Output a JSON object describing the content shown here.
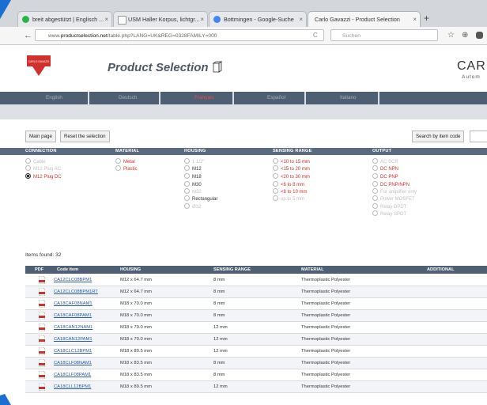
{
  "browser": {
    "tabs": [
      {
        "label": "breit abgestützt | Englisch ...",
        "icon": "green-circle-icon"
      },
      {
        "label": "USM Haller Korpus, lichtgr...",
        "icon": "page-icon"
      },
      {
        "label": "Bottmingen - Google-Suche",
        "icon": "google-icon"
      },
      {
        "label": "Carlo Gavazzi - Product Selection",
        "icon": "page-icon"
      }
    ],
    "new_tab": "+",
    "close_glyph": "×",
    "url_prefix": "www.",
    "url_domain": "productselection.net",
    "url_path": "/table.php?LANG=UK&REG=0328FAMILY=000",
    "search_placeholder": "Suchen",
    "back_glyph": "←",
    "reload_glyph": "C",
    "star_glyph": "☆",
    "lock_glyph": "⊕"
  },
  "site": {
    "logo_text": "CARLO GAVAZZI",
    "title": "Product Selection",
    "brand": "CARL",
    "brand_sub": "Autom",
    "languages": [
      "English",
      "Deutsch",
      "Français",
      "Español",
      "Italiano"
    ],
    "selected_language": "Français",
    "buttons": {
      "main_page": "Main page",
      "reset": "Reset the selection",
      "search_code": "Search by item code"
    },
    "filters": [
      {
        "heading": "CONNECTION",
        "options": [
          {
            "label": "Cable",
            "state": "disabled"
          },
          {
            "label": "M12 Plug AC",
            "state": "disabled"
          },
          {
            "label": "M12 Plug DC",
            "state": "checked"
          }
        ]
      },
      {
        "heading": "MATERIAL",
        "options": [
          {
            "label": "Metal",
            "state": "available"
          },
          {
            "label": "Plastic",
            "state": "available"
          }
        ]
      },
      {
        "heading": "HOUSING",
        "options": [
          {
            "label": "1 1/2\"",
            "state": "disabled"
          },
          {
            "label": "M12",
            "state": "enabled"
          },
          {
            "label": "M18",
            "state": "enabled"
          },
          {
            "label": "M30",
            "state": "enabled"
          },
          {
            "label": "M32",
            "state": "disabled"
          },
          {
            "label": "Rectangular",
            "state": "enabled"
          },
          {
            "label": "Ø32",
            "state": "disabled"
          }
        ]
      },
      {
        "heading": "SENSING RANGE",
        "options": [
          {
            "label": "<10 to 15 mm",
            "state": "available"
          },
          {
            "label": "<15 to 20 mm",
            "state": "available"
          },
          {
            "label": "<20 to 30 mm",
            "state": "available"
          },
          {
            "label": "<6 to 8 mm",
            "state": "available"
          },
          {
            "label": "<8 to 10 mm",
            "state": "available"
          },
          {
            "label": "up to 5 mm",
            "state": "disabled"
          }
        ]
      },
      {
        "heading": "OUTPUT",
        "options": [
          {
            "label": "AC SCR",
            "state": "disabled"
          },
          {
            "label": "DC NPN",
            "state": "available"
          },
          {
            "label": "DC PNP",
            "state": "available"
          },
          {
            "label": "DC PNP/NPN",
            "state": "available"
          },
          {
            "label": "For amplifier only",
            "state": "disabled"
          },
          {
            "label": "Power MOSFET",
            "state": "disabled"
          },
          {
            "label": "Relay DPDT",
            "state": "disabled"
          },
          {
            "label": "Relay SPDT",
            "state": "disabled"
          }
        ]
      }
    ],
    "items_found": "Items found: 32",
    "table": {
      "columns": [
        "PDF",
        "Code item",
        "HOUSING",
        "SENSING RANGE",
        "MATERIAL",
        "ADDITIONAL"
      ],
      "rows": [
        {
          "code": "CA12CLC08BPM1",
          "housing": "M12 x 64.7 mm",
          "range": "8 mm",
          "material": "Thermoplastic Polyester"
        },
        {
          "code": "CA12CLC08BPM1RT",
          "housing": "M12 x 64.7 mm",
          "range": "8 mm",
          "material": "Thermoplastic Polyester"
        },
        {
          "code": "CA18CAF08NAM1",
          "housing": "M18 x 70.0 mm",
          "range": "8 mm",
          "material": "Thermoplastic Polyester"
        },
        {
          "code": "CA18CAF08PAM1",
          "housing": "M18 x 70.0 mm",
          "range": "8 mm",
          "material": "Thermoplastic Polyester"
        },
        {
          "code": "CA18CAN12NAM1",
          "housing": "M18 x 70.0 mm",
          "range": "12 mm",
          "material": "Thermoplastic Polyester"
        },
        {
          "code": "CA18CAN12PAM1",
          "housing": "M18 x 70.0 mm",
          "range": "12 mm",
          "material": "Thermoplastic Polyester"
        },
        {
          "code": "CA18CLC12BPM1",
          "housing": "M18 x 89.5 mm",
          "range": "12 mm",
          "material": "Thermoplastic Polyester"
        },
        {
          "code": "CA18CLF08NAM1",
          "housing": "M18 x 83.5 mm",
          "range": "8 mm",
          "material": "Thermoplastic Polyester"
        },
        {
          "code": "CA18CLF08PAM1",
          "housing": "M18 x 83.5 mm",
          "range": "8 mm",
          "material": "Thermoplastic Polyester"
        },
        {
          "code": "CA18CLL12BPM1",
          "housing": "M18 x 89.5 mm",
          "range": "12 mm",
          "material": "Thermoplastic Polyester"
        }
      ]
    }
  },
  "colors": {
    "accent_red": "#d0312d",
    "nav_bar": "#4e5e73",
    "link_blue": "#2a5aa8",
    "frame_blue": "#1a6fd0"
  }
}
